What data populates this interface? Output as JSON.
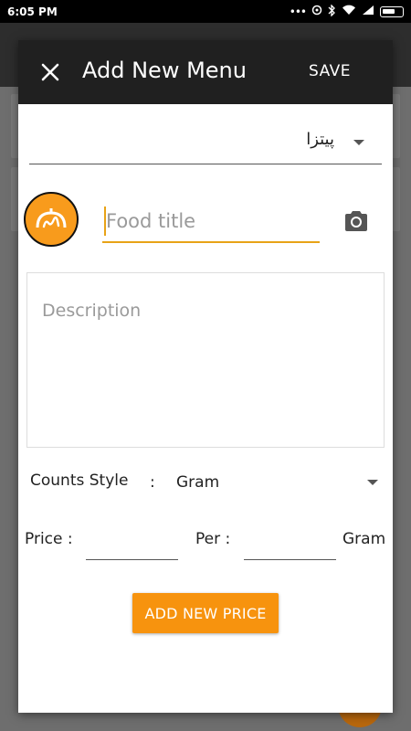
{
  "status_bar": {
    "time": "6:05 PM",
    "icons": [
      "more-dots-icon",
      "sync-icon",
      "bluetooth-icon",
      "wifi-icon",
      "signal-icon",
      "battery-icon"
    ]
  },
  "dialog": {
    "title": "Add New Menu",
    "close_icon": "close-icon",
    "save_label": "SAVE",
    "category": {
      "selected": "پیتزا"
    },
    "food_title": {
      "placeholder": "Food title",
      "value": ""
    },
    "description": {
      "placeholder": "Description",
      "value": ""
    },
    "counts_style": {
      "label": "Counts Style",
      "separator": ":",
      "selected": "Gram"
    },
    "price": {
      "price_label": "Price :",
      "per_label": "Per :",
      "unit": "Gram",
      "price_value": "",
      "per_value": ""
    },
    "add_price_label": "ADD NEW PRICE"
  },
  "colors": {
    "accent": "#F7930E",
    "header": "#202020",
    "logo": "#F89B1C"
  }
}
